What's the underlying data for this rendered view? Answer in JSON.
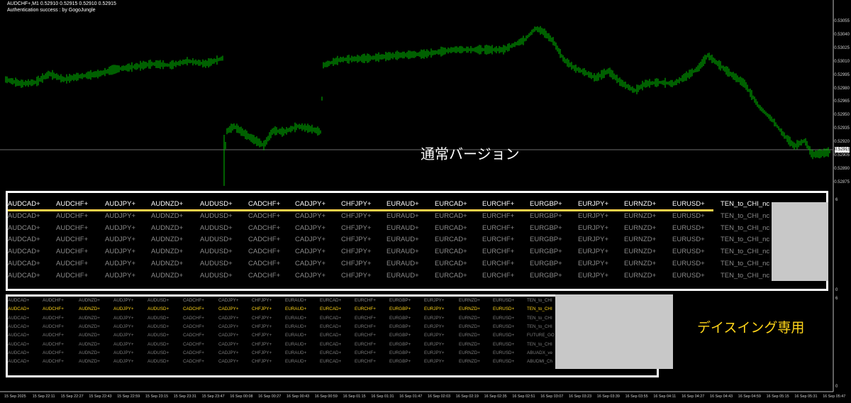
{
  "chart": {
    "symbol_line": "AUDCHF+,M1  0.52910 0.52915 0.52910 0.52915",
    "auth_line": "Authentication success : by GogoJungle",
    "current_price": "0.52915",
    "price_levels": [
      "0.53055",
      "0.53040",
      "0.53025",
      "0.53010",
      "0.52995",
      "0.52980",
      "0.52965",
      "0.52950",
      "0.52935",
      "0.52920",
      "0.52905",
      "0.52890",
      "0.52875"
    ],
    "time_labels": [
      "15 Sep 2025",
      "15 Sep 22:11",
      "15 Sep 22:27",
      "15 Sep 22:43",
      "15 Sep 22:59",
      "15 Sep 23:15",
      "15 Sep 23:31",
      "15 Sep 23:47",
      "16 Sep 00:08",
      "16 Sep 00:27",
      "16 Sep 00:43",
      "16 Sep 00:59",
      "16 Sep 01:15",
      "16 Sep 01:31",
      "16 Sep 01:47",
      "16 Sep 02:03",
      "16 Sep 02:19",
      "16 Sep 02:35",
      "16 Sep 02:51",
      "16 Sep 03:07",
      "16 Sep 03:23",
      "16 Sep 03:39",
      "16 Sep 03:55",
      "16 Sep 04:11",
      "16 Sep 04:27",
      "16 Sep 04:43",
      "16 Sep 04:59",
      "16 Sep 05:15",
      "16 Sep 05:31",
      "16 Sep 05:47"
    ],
    "candle_color": "#00c000"
  },
  "panel1": {
    "label": "通常バージョン",
    "scale_top": "6",
    "scale_bottom": "0",
    "header": [
      "AUDCAD+",
      "AUDCHF+",
      "AUDJPY+",
      "AUDNZD+",
      "AUDUSD+",
      "CADCHF+",
      "CADJPY+",
      "CHFJPY+",
      "EURAUD+",
      "EURCAD+",
      "EURCHF+",
      "EURGBP+",
      "EURJPY+",
      "EURNZD+",
      "EURUSD+",
      "TEN_to_CHI_nc"
    ],
    "rows": [
      [
        "AUDCAD+",
        "AUDCHF+",
        "AUDJPY+",
        "AUDNZD+",
        "AUDUSD+",
        "CADCHF+",
        "CADJPY+",
        "CHFJPY+",
        "EURAUD+",
        "EURCAD+",
        "EURCHF+",
        "EURGBP+",
        "EURJPY+",
        "EURNZD+",
        "EURUSD+",
        "TEN_to_CHI_nc"
      ],
      [
        "AUDCAD+",
        "AUDCHF+",
        "AUDJPY+",
        "AUDNZD+",
        "AUDUSD+",
        "CADCHF+",
        "CADJPY+",
        "CHFJPY+",
        "EURAUD+",
        "EURCAD+",
        "EURCHF+",
        "EURGBP+",
        "EURJPY+",
        "EURNZD+",
        "EURUSD+",
        "TEN_to_CHI_nc"
      ],
      [
        "AUDCAD+",
        "AUDCHF+",
        "AUDJPY+",
        "AUDNZD+",
        "AUDUSD+",
        "CADCHF+",
        "CADJPY+",
        "CHFJPY+",
        "EURAUD+",
        "EURCAD+",
        "EURCHF+",
        "EURGBP+",
        "EURJPY+",
        "EURNZD+",
        "EURUSD+",
        "TEN_to_CHI_nc"
      ],
      [
        "AUDCAD+",
        "AUDCHF+",
        "AUDJPY+",
        "AUDNZD+",
        "AUDUSD+",
        "CADCHF+",
        "CADJPY+",
        "CHFJPY+",
        "EURAUD+",
        "EURCAD+",
        "EURCHF+",
        "EURGBP+",
        "EURJPY+",
        "EURNZD+",
        "EURUSD+",
        "TEN_to_CHI_nc"
      ],
      [
        "AUDCAD+",
        "AUDCHF+",
        "AUDJPY+",
        "AUDNZD+",
        "AUDUSD+",
        "CADCHF+",
        "CADJPY+",
        "CHFJPY+",
        "EURAUD+",
        "EURCAD+",
        "EURCHF+",
        "EURGBP+",
        "EURJPY+",
        "EURNZD+",
        "EURUSD+",
        "TEN_to_CHI_nc"
      ],
      [
        "AUDCAD+",
        "AUDCHF+",
        "AUDJPY+",
        "AUDNZD+",
        "AUDUSD+",
        "CADCHF+",
        "CADJPY+",
        "CHFJPY+",
        "EURAUD+",
        "EURCAD+",
        "EURCHF+",
        "EURGBP+",
        "EURJPY+",
        "EURNZD+",
        "EURUSD+",
        "TEN_to_CHI_nc"
      ]
    ],
    "highlight_line_color": "#ffd24a"
  },
  "panel2": {
    "label": "デイスイング専用",
    "scale_top": "6",
    "scale_bottom": "0",
    "rows": [
      [
        "AUDCAD+",
        "AUDCHF+",
        "AUDNZD+",
        "AUDJPY+",
        "AUDUSD+",
        "CADCHF+",
        "CADJPY+",
        "CHFJPY+",
        "EURAUD+",
        "EURCAD+",
        "EURCHF+",
        "EURGBP+",
        "EURJPY+",
        "EURNZD+",
        "EURUSD+",
        "TEN_to_CHI"
      ],
      [
        "AUDCAD+",
        "AUDCHF+",
        "AUDNZD+",
        "AUDJPY+",
        "AUDUSD+",
        "CADCHF+",
        "CADJPY+",
        "CHFJPY+",
        "EURAUD+",
        "EURCAD+",
        "EURCHF+",
        "EURGBP+",
        "EURJPY+",
        "EURNZD+",
        "EURUSD+",
        "TEN_to_CHI"
      ],
      [
        "AUDCAD+",
        "AUDCHF+",
        "AUDNZD+",
        "AUDJPY+",
        "AUDUSD+",
        "CADCHF+",
        "CADJPY+",
        "CHFJPY+",
        "EURAUD+",
        "EURCAD+",
        "EURCHF+",
        "EURGBP+",
        "EURJPY+",
        "EURNZD+",
        "EURUSD+",
        "TEN_to_CHI"
      ],
      [
        "AUDCAD+",
        "AUDCHF+",
        "AUDNZD+",
        "AUDJPY+",
        "AUDUSD+",
        "CADCHF+",
        "CADJPY+",
        "CHFJPY+",
        "EURAUD+",
        "EURCAD+",
        "EURCHF+",
        "EURGBP+",
        "EURJPY+",
        "EURNZD+",
        "EURUSD+",
        "TEN_to_CHI"
      ],
      [
        "AUDCAD+",
        "AUDCHF+",
        "AUDNZD+",
        "AUDJPY+",
        "AUDUSD+",
        "CADCHF+",
        "CADJPY+",
        "CHFJPY+",
        "EURAUD+",
        "EURCAD+",
        "EURCHF+",
        "EURGBP+",
        "EURJPY+",
        "EURNZD+",
        "EURUSD+",
        "FUTURE_GO"
      ],
      [
        "AUDCAD+",
        "AUDCHF+",
        "AUDNZD+",
        "AUDJPY+",
        "AUDUSD+",
        "CADCHF+",
        "CADJPY+",
        "CHFJPY+",
        "EURAUD+",
        "EURCAD+",
        "EURCHF+",
        "EURGBP+",
        "EURJPY+",
        "EURNZD+",
        "EURUSD+",
        "TEN_to_CHI"
      ],
      [
        "AUDCAD+",
        "AUDCHF+",
        "AUDNZD+",
        "AUDJPY+",
        "AUDUSD+",
        "CADCHF+",
        "CADJPY+",
        "CHFJPY+",
        "EURAUD+",
        "EURCAD+",
        "EURCHF+",
        "EURGBP+",
        "EURJPY+",
        "EURNZD+",
        "EURUSD+",
        "ABUADX_ve"
      ],
      [
        "AUDCAD+",
        "AUDCHF+",
        "AUDNZD+",
        "AUDJPY+",
        "AUDUSD+",
        "CADCHF+",
        "CADJPY+",
        "CHFJPY+",
        "EURAUD+",
        "EURCAD+",
        "EURCHF+",
        "EURGBP+",
        "EURJPY+",
        "EURNZD+",
        "EURUSD+",
        "ABUDMI_Ch"
      ]
    ],
    "yellow_row_index": 1,
    "yellow_color": "#ffd51a"
  }
}
